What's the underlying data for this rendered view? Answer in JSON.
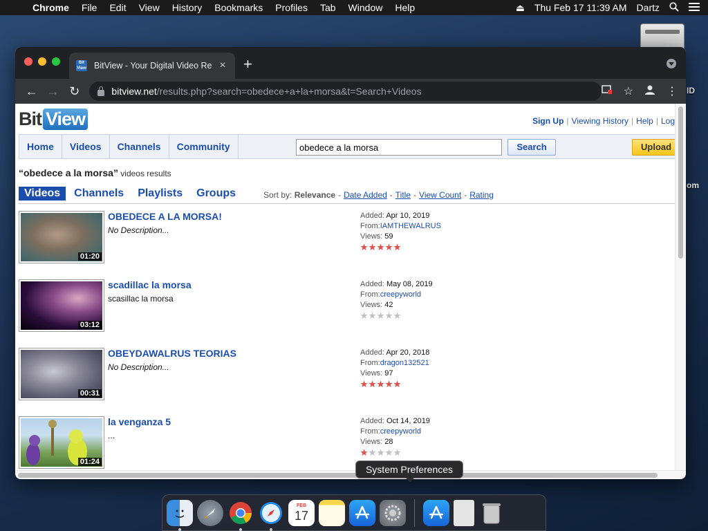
{
  "menubar": {
    "app_name": "Chrome",
    "items": [
      "File",
      "Edit",
      "View",
      "History",
      "Bookmarks",
      "Profiles",
      "Tab",
      "Window",
      "Help"
    ],
    "datetime": "Thu Feb 17  11:39 AM",
    "user": "Dartz"
  },
  "desktop": {
    "label_partial_1": "ID",
    "label_partial_2": "om"
  },
  "browser": {
    "tab_title": "BitView - Your Digital Video Re",
    "url_host": "bitview.net",
    "url_path": "/results.php?search=obedece+a+la+morsa&t=Search+Videos",
    "favicon_text": "Bit View"
  },
  "site": {
    "logo_bit": "Bit",
    "logo_view": "View",
    "top_links": {
      "signup": "Sign Up",
      "history": "Viewing History",
      "help": "Help",
      "login": "Log"
    },
    "nav": [
      "Home",
      "Videos",
      "Channels",
      "Community"
    ],
    "search": {
      "value": "obedece a la morsa",
      "button": "Search"
    },
    "upload": "Upload"
  },
  "results": {
    "query": "“obedece a la morsa”",
    "suffix": " videos results",
    "filter_tabs": [
      "Videos",
      "Channels",
      "Playlists",
      "Groups"
    ],
    "sort": {
      "label": "Sort by:",
      "current": "Relevance",
      "options": [
        "Date Added",
        "Title",
        "View Count",
        "Rating"
      ]
    },
    "meta_labels": {
      "added": "Added:",
      "from": "From:",
      "views": "Views:"
    },
    "items": [
      {
        "title": "OBEDECE A LA MORSA!",
        "description": "No Description...",
        "added": "Apr 10, 2019",
        "from": "IAMTHEWALRUS",
        "views": "59",
        "rating": 5,
        "duration": "01:20"
      },
      {
        "title": "scadillac la morsa",
        "description": "scasillac la morsa",
        "added": "May 08, 2019",
        "from": "creepyworld",
        "views": "42",
        "rating": 0,
        "duration": "03:12"
      },
      {
        "title": "OBEYDAWALRUS TEORIAS",
        "description": "No Description...",
        "added": "Apr 20, 2018",
        "from": "dragon132521",
        "views": "97",
        "rating": 5,
        "duration": "00:31"
      },
      {
        "title": "la venganza 5",
        "description": "...",
        "added": "Oct 14, 2019",
        "from": "creepyworld",
        "views": "28",
        "rating": 1,
        "duration": "01:24"
      }
    ]
  },
  "dock": {
    "tooltip": "System Preferences",
    "apps": [
      "finder-icon",
      "launchpad-icon",
      "chrome-icon",
      "safari-icon",
      "calendar-icon",
      "notes-icon",
      "app-store-icon",
      "system-preferences-icon",
      "app-store-icon",
      "document-icon",
      "trash-icon"
    ],
    "calendar_month": "FEB",
    "calendar_day": "17"
  }
}
